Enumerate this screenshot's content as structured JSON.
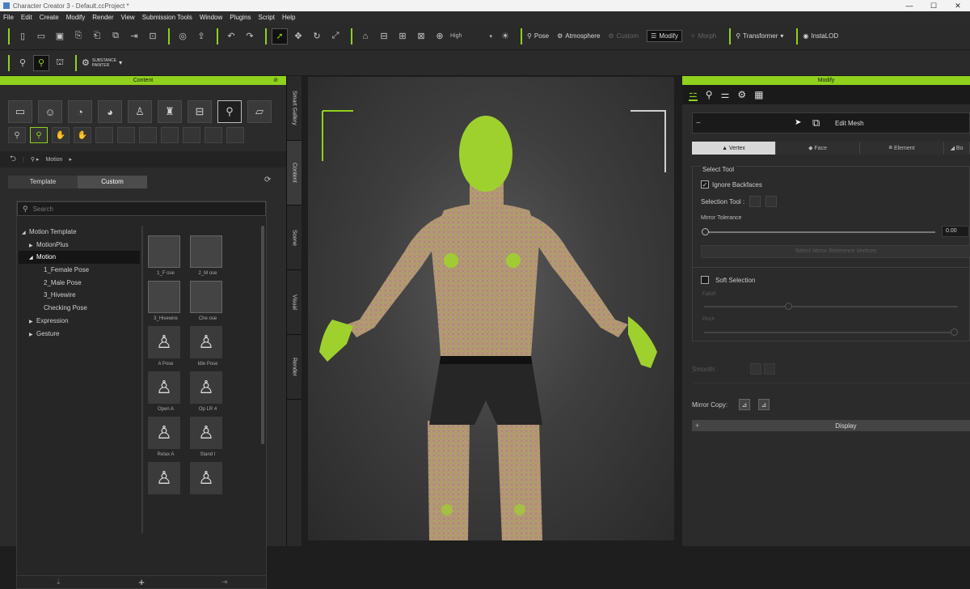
{
  "window": {
    "title": "Character Creator 3 - Default.ccProject *",
    "controls": [
      "—",
      "☐",
      "✕"
    ]
  },
  "menu": [
    "File",
    "Edit",
    "Create",
    "Modify",
    "Render",
    "View",
    "Submission Tools",
    "Window",
    "Plugins",
    "Script",
    "Help"
  ],
  "toolbar": {
    "quality_value": "High",
    "pose_label": "Pose",
    "atmosphere_label": "Atmosphere",
    "custom_label": "Custom",
    "modify_label": "Modify",
    "morph_label": "Morph",
    "transformer_label": "Transformer",
    "install_label": "InstaLOD",
    "substance_label_1": "SUBSTANCE",
    "substance_label_2": "PAINTER"
  },
  "content": {
    "title": "Content",
    "breadcrumb": "Motion",
    "tabs": [
      "Template",
      "Custom"
    ],
    "search_placeholder": "Search",
    "tree": [
      {
        "label": "Motion Template",
        "arrow": "◢",
        "indent": 0,
        "selected": false
      },
      {
        "label": "MotionPlus",
        "arrow": "▶",
        "indent": 1,
        "selected": false
      },
      {
        "label": "Motion",
        "arrow": "◢",
        "indent": 1,
        "selected": true
      },
      {
        "label": "1_Female Pose",
        "arrow": "",
        "indent": 2,
        "selected": false
      },
      {
        "label": "2_Male Pose",
        "arrow": "",
        "indent": 2,
        "selected": false
      },
      {
        "label": "3_Hivewire",
        "arrow": "",
        "indent": 2,
        "selected": false
      },
      {
        "label": "Checking Pose",
        "arrow": "",
        "indent": 2,
        "selected": false
      },
      {
        "label": "Expression",
        "arrow": "▶",
        "indent": 1,
        "selected": false
      },
      {
        "label": "Gesture",
        "arrow": "▶",
        "indent": 1,
        "selected": false
      }
    ],
    "thumbs": [
      {
        "caption": "1_F   ose",
        "kind": "folder"
      },
      {
        "caption": "2_M   ose",
        "kind": "folder"
      },
      {
        "caption": "3_Hivewire",
        "kind": "folder"
      },
      {
        "caption": "Che   ose",
        "kind": "folder"
      },
      {
        "caption": "A Pose",
        "kind": "pose"
      },
      {
        "caption": "Idle Pose",
        "kind": "pose"
      },
      {
        "caption": "Open A",
        "kind": "pose"
      },
      {
        "caption": "Op  LR 4",
        "kind": "pose"
      },
      {
        "caption": "Relax A",
        "kind": "pose"
      },
      {
        "caption": "Stand I",
        "kind": "pose"
      },
      {
        "caption": "",
        "kind": "pose"
      },
      {
        "caption": "",
        "kind": "pose"
      }
    ],
    "footer_add": "+"
  },
  "vtabs": [
    "Smart Gallery",
    "Content",
    "Scene",
    "Visual",
    "Render"
  ],
  "modify": {
    "title": "Modify",
    "edit_mesh_label": "Edit Mesh",
    "collapse_symbol": "−",
    "subtabs": [
      "Vertex",
      "Face",
      "Element",
      "Bo"
    ],
    "select_tool_title": "Select Tool",
    "ignore_backfaces_label": "Ignore Backfaces",
    "ignore_backfaces_checked": "✓",
    "selection_tool_label": "Selection Tool :",
    "mirror_tolerance_label": "Mirror Tolerance",
    "mirror_tolerance_value": "0.00",
    "reverse_btn_label": "Select Mirror Reference Vertices",
    "soft_selection_label": "Soft Selection",
    "falloff_label": "Falloff",
    "pinch_label": "Pinch",
    "smooth_label": "Smooth:",
    "mirror_copy_label": "Mirror Copy:",
    "display_label": "Display",
    "display_expand": "+"
  }
}
